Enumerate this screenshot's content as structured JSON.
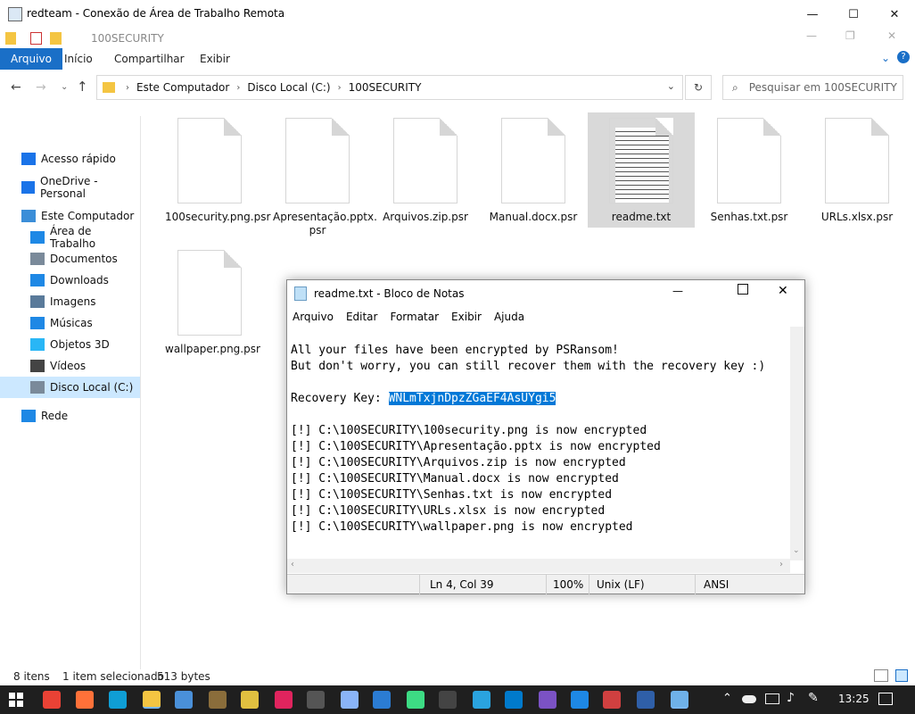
{
  "rdp": {
    "title": "redteam - Conexão de Área de Trabalho Remota",
    "min": "—",
    "max": "☐",
    "close": "✕"
  },
  "explorer": {
    "qat_title": "100SECURITY",
    "tabs": [
      {
        "label": "Arquivo"
      },
      {
        "label": "Início"
      },
      {
        "label": "Compartilhar"
      },
      {
        "label": "Exibir"
      }
    ],
    "breadcrumb": [
      {
        "label": "Este Computador"
      },
      {
        "label": "Disco Local (C:)"
      },
      {
        "label": "100SECURITY"
      }
    ],
    "search_placeholder": "Pesquisar em 100SECURITY",
    "nav": [
      {
        "label": "Acesso rápido",
        "color": "#1a73e8"
      },
      {
        "label": "OneDrive - Personal",
        "color": "#1a73e8"
      },
      {
        "label": "Este Computador",
        "color": "#3b8ed8"
      },
      {
        "label": "Área de Trabalho",
        "color": "#1e88e5"
      },
      {
        "label": "Documentos",
        "color": "#7a8a9a"
      },
      {
        "label": "Downloads",
        "color": "#1e88e5"
      },
      {
        "label": "Imagens",
        "color": "#5a7a9a"
      },
      {
        "label": "Músicas",
        "color": "#1e88e5"
      },
      {
        "label": "Objetos 3D",
        "color": "#29b6f6"
      },
      {
        "label": "Vídeos",
        "color": "#444444"
      },
      {
        "label": "Disco Local (C:)",
        "color": "#7a8a9a"
      },
      {
        "label": "Rede",
        "color": "#1e88e5"
      }
    ],
    "files": [
      {
        "name": "100security.png.psr"
      },
      {
        "name": "Apresentação.pptx.\npsr"
      },
      {
        "name": "Arquivos.zip.psr"
      },
      {
        "name": "Manual.docx.psr"
      },
      {
        "name": "readme.txt"
      },
      {
        "name": "Senhas.txt.psr"
      },
      {
        "name": "URLs.xlsx.psr"
      },
      {
        "name": "wallpaper.png.psr"
      }
    ],
    "status": {
      "count": "8 itens",
      "selected": "1 item selecionado",
      "size": "513 bytes"
    }
  },
  "notepad": {
    "title": "readme.txt - Bloco de Notas",
    "menu": [
      {
        "label": "Arquivo"
      },
      {
        "label": "Editar"
      },
      {
        "label": "Formatar"
      },
      {
        "label": "Exibir"
      },
      {
        "label": "Ajuda"
      }
    ],
    "line1": "All your files have been encrypted by PSRansom!",
    "line2": "But don't worry, you can still recover them with the recovery key :)",
    "key_label": "Recovery Key: ",
    "key_value": "WNLmTxjnDpzZGaEF4AsUYgi5",
    "log": [
      "[!] C:\\100SECURITY\\100security.png is now encrypted",
      "[!] C:\\100SECURITY\\Apresentação.pptx is now encrypted",
      "[!] C:\\100SECURITY\\Arquivos.zip is now encrypted",
      "[!] C:\\100SECURITY\\Manual.docx is now encrypted",
      "[!] C:\\100SECURITY\\Senhas.txt is now encrypted",
      "[!] C:\\100SECURITY\\URLs.xlsx is now encrypted",
      "[!] C:\\100SECURITY\\wallpaper.png is now encrypted"
    ],
    "status": {
      "pos": "Ln 4, Col 39",
      "zoom": "100%",
      "eol": "Unix (LF)",
      "enc": "ANSI"
    }
  },
  "taskbar": {
    "time": "13:25",
    "icons": [
      {
        "name": "chrome-icon",
        "color": "#e94235"
      },
      {
        "name": "firefox-icon",
        "color": "#ff7139"
      },
      {
        "name": "edge-icon",
        "color": "#0f9ed5"
      },
      {
        "name": "file-explorer-icon",
        "color": "#f4c542"
      },
      {
        "name": "app-icon-1",
        "color": "#4a90d9"
      },
      {
        "name": "app-icon-2",
        "color": "#8a6d3b"
      },
      {
        "name": "app-icon-3",
        "color": "#e0c040"
      },
      {
        "name": "app-icon-4",
        "color": "#e0245e"
      },
      {
        "name": "terminal-icon",
        "color": "#555555"
      },
      {
        "name": "app-icon-5",
        "color": "#8ab4f8"
      },
      {
        "name": "app-icon-6",
        "color": "#2b7cd3"
      },
      {
        "name": "android-icon",
        "color": "#3ddc84"
      },
      {
        "name": "cmd-icon",
        "color": "#444444"
      },
      {
        "name": "telegram-icon",
        "color": "#2aa3df"
      },
      {
        "name": "vscode-icon",
        "color": "#007acc"
      },
      {
        "name": "app-icon-7",
        "color": "#7b52c4"
      },
      {
        "name": "remote-desktop-icon",
        "color": "#1e88e5"
      },
      {
        "name": "app-icon-8",
        "color": "#d04040"
      },
      {
        "name": "powershell-icon",
        "color": "#2f5fa8"
      },
      {
        "name": "notepad-icon",
        "color": "#6fb1e8"
      }
    ]
  }
}
